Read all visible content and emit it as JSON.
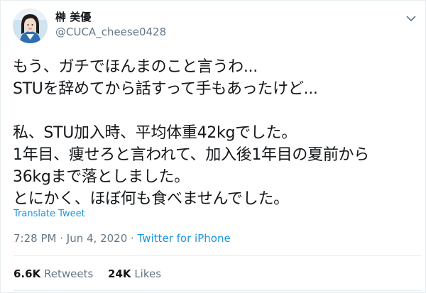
{
  "author": {
    "display_name": "榊 美優",
    "handle": "@CUCA_cheese0428"
  },
  "tweet": {
    "text": "もう、ガチでほんまのこと言うわ...\nSTUを辞めてから話すって手もあったけど...\n\n私、STU加入時、平均体重42kgでした。\n1年目、痩せろと言われて、加入後1年目の夏前から\n36kgまで落としました。\nとにかく、ほぼ何も食べませんでした。",
    "translate_label": "Translate Tweet",
    "time": "7:28 PM",
    "separator": "·",
    "date": "Jun 4, 2020",
    "source": "Twitter for iPhone"
  },
  "stats": {
    "retweets_count": "6.6K",
    "retweets_label": "Retweets",
    "likes_count": "24K",
    "likes_label": "Likes"
  },
  "icons": {
    "menu": "chevron-down-icon",
    "avatar": "profile-photo"
  },
  "colors": {
    "link": "#1b95e0",
    "secondary_text": "#657786",
    "divider": "#e6ecf0",
    "primary_text": "#14171a"
  }
}
